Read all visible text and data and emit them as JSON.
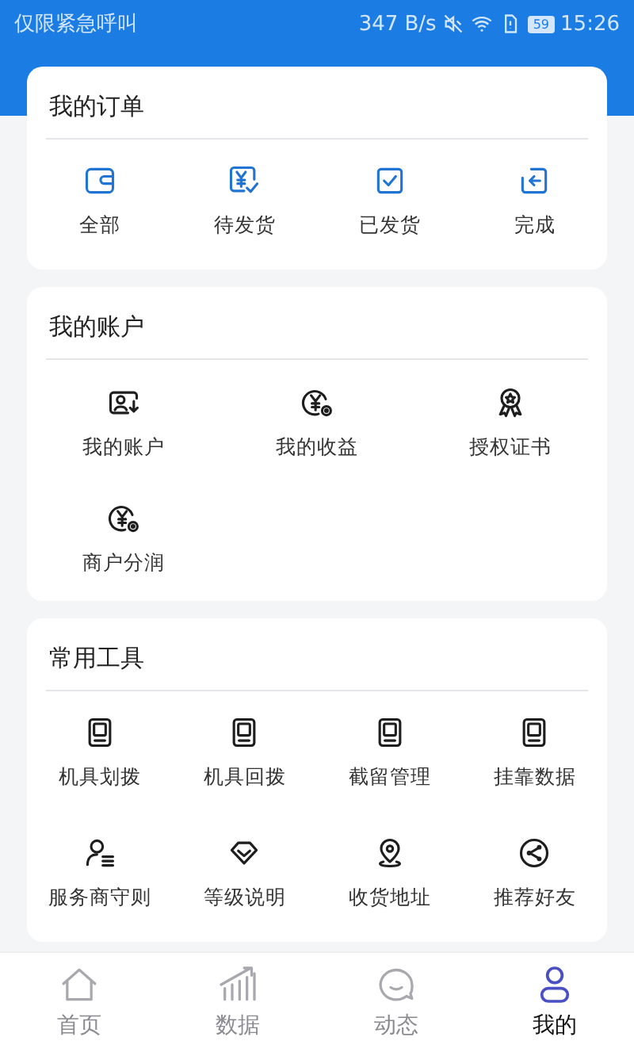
{
  "status_bar": {
    "carrier": "仅限紧急呼叫",
    "speed": "347 B/s",
    "battery": "59",
    "time": "15:26"
  },
  "sections": [
    {
      "title": "我的订单",
      "kind": "orders",
      "items": [
        "全部",
        "待发货",
        "已发货",
        "完成"
      ]
    },
    {
      "title": "我的账户",
      "kind": "account",
      "items": [
        "我的账户",
        "我的收益",
        "授权证书",
        "商户分润"
      ]
    },
    {
      "title": "常用工具",
      "kind": "tools",
      "items": [
        "机具划拨",
        "机具回拨",
        "截留管理",
        "挂靠数据",
        "服务商守则",
        "等级说明",
        "收货地址",
        "推荐好友"
      ]
    }
  ],
  "tabs": [
    {
      "label": "首页",
      "selected": false
    },
    {
      "label": "数据",
      "selected": false
    },
    {
      "label": "动态",
      "selected": false
    },
    {
      "label": "我的",
      "selected": true
    }
  ]
}
